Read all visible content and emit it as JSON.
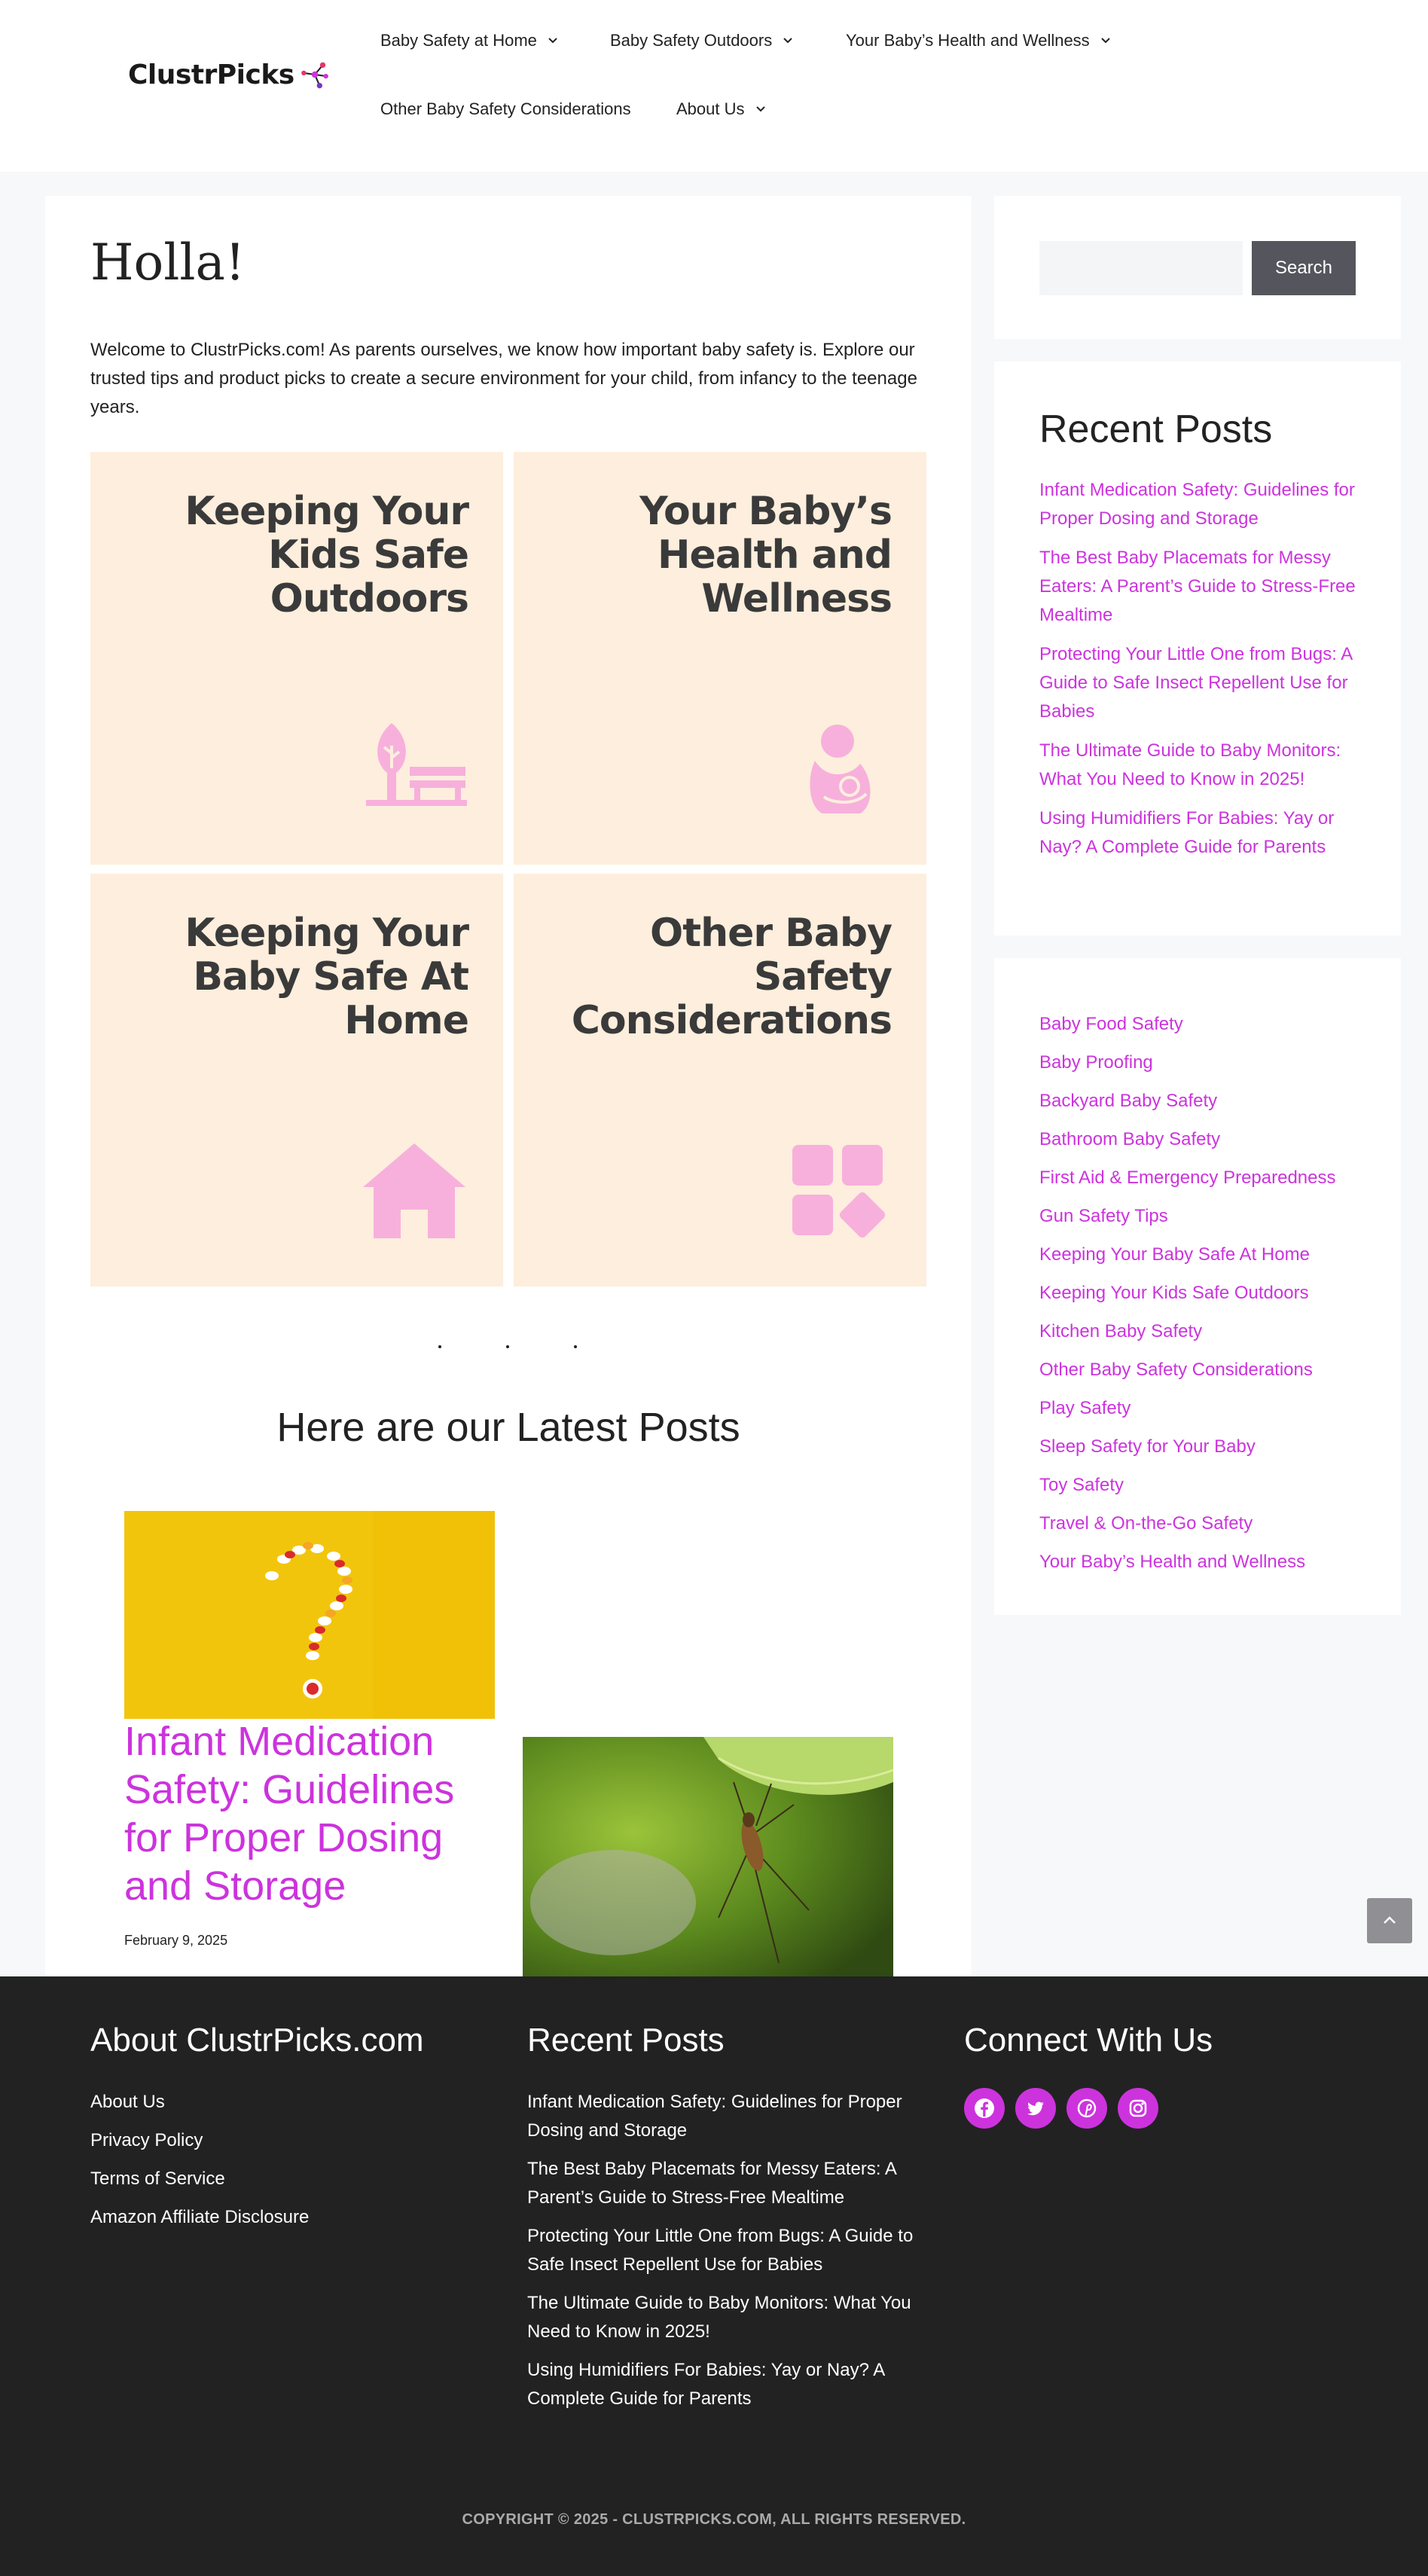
{
  "brand": {
    "name": "ClustrPicks",
    "accent_color": "#cc33dd",
    "logo_icon": "molecule-icon"
  },
  "nav": {
    "items": [
      {
        "label": "Baby Safety at Home",
        "has_dropdown": true
      },
      {
        "label": "Baby Safety Outdoors",
        "has_dropdown": true
      },
      {
        "label": "Your Baby’s Health and Wellness",
        "has_dropdown": true
      },
      {
        "label": "Other Baby Safety Considerations",
        "has_dropdown": false
      },
      {
        "label": "About Us",
        "has_dropdown": true
      }
    ]
  },
  "main": {
    "title": "Holla!",
    "intro": "Welcome to ClustrPicks.com! As parents ourselves, we know how important baby safety is. Explore our trusted tips and product picks to create a secure environment for your child, from infancy to the teenage years.",
    "tiles": [
      {
        "title": "Keeping Your Kids Safe Outdoors",
        "icon": "park-bench-tree-icon"
      },
      {
        "title": "Your Baby’s Health and Wellness",
        "icon": "mother-baby-icon"
      },
      {
        "title": "Keeping Your Baby Safe At Home",
        "icon": "house-icon"
      },
      {
        "title": "Other Baby Safety Considerations",
        "icon": "category-grid-icon"
      }
    ],
    "tile_bg_color": "#fdeedd",
    "tile_icon_color": "#f7b0dc",
    "latest_heading": "Here are our Latest Posts",
    "posts": [
      {
        "title": "Infant Medication Safety: Guidelines for Proper Dosing and Storage",
        "date": "February 9, 2025",
        "image": "pills-question-mark-image"
      },
      {
        "image": "mosquito-on-leaf-image"
      }
    ]
  },
  "sidebar": {
    "search": {
      "placeholder": "",
      "button_label": "Search"
    },
    "recent_posts": {
      "title": "Recent Posts",
      "items": [
        "Infant Medication Safety: Guidelines for Proper Dosing and Storage",
        "The Best Baby Placemats for Messy Eaters: A Parent’s Guide to Stress-Free Mealtime",
        "Protecting Your Little One from Bugs: A Guide to Safe Insect Repellent Use for Babies",
        "The Ultimate Guide to Baby Monitors: What You Need to Know in 2025!",
        "Using Humidifiers For Babies: Yay or Nay? A Complete Guide for Parents"
      ]
    },
    "categories": [
      "Baby Food Safety",
      "Baby Proofing",
      "Backyard Baby Safety",
      "Bathroom Baby Safety",
      "First Aid & Emergency Preparedness",
      "Gun Safety Tips",
      "Keeping Your Baby Safe At Home",
      "Keeping Your Kids Safe Outdoors",
      "Kitchen Baby Safety",
      "Other Baby Safety Considerations",
      "Play Safety",
      "Sleep Safety for Your Baby",
      "Toy Safety",
      "Travel & On-the-Go Safety",
      "Your Baby’s Health and Wellness"
    ]
  },
  "footer": {
    "about": {
      "title": "About ClustrPicks.com",
      "links": [
        "About Us",
        "Privacy Policy",
        "Terms of Service",
        "Amazon Affiliate Disclosure"
      ]
    },
    "recent": {
      "title": "Recent Posts",
      "links": [
        "Infant Medication Safety: Guidelines for Proper Dosing and Storage",
        "The Best Baby Placemats for Messy Eaters: A Parent’s Guide to Stress-Free Mealtime",
        "Protecting Your Little One from Bugs: A Guide to Safe Insect Repellent Use for Babies",
        "The Ultimate Guide to Baby Monitors: What You Need to Know in 2025!",
        "Using Humidifiers For Babies: Yay or Nay? A Complete Guide for Parents"
      ]
    },
    "connect": {
      "title": "Connect With Us",
      "icons": [
        "facebook-icon",
        "twitter-icon",
        "pinterest-icon",
        "instagram-icon"
      ]
    },
    "copyright": "COPYRIGHT © 2025 - CLUSTRPICKS.COM, ALL RIGHTS RESERVED."
  }
}
